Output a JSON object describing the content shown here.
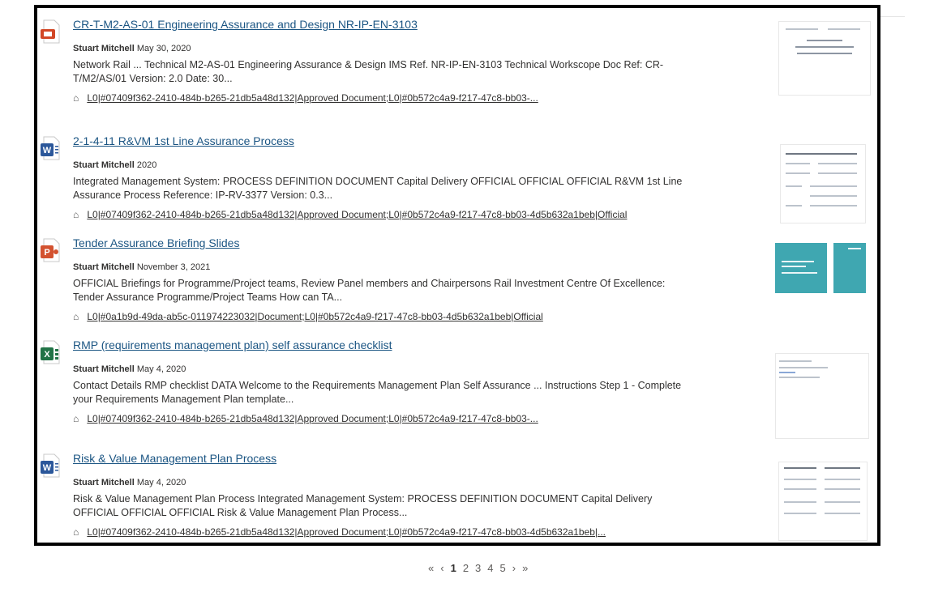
{
  "results": [
    {
      "type": "pdf",
      "title": "CR-T-M2-AS-01 Engineering Assurance and Design NR-IP-EN-3103",
      "author": "Stuart Mitchell",
      "date": "May 30, 2020",
      "snippet": "Network Rail ... Technical M2-AS-01 Engineering Assurance & Design IMS Ref. NR-IP-EN-3103 Technical Workscope Doc Ref: CR-T/M2/AS/01 Version: 2.0 Date: 30...",
      "tags": "L0|#07409f362-2410-484b-b265-21db5a48d132|Approved Document;L0|#0b572c4a9-f217-47c8-bb03-..."
    },
    {
      "type": "word",
      "title": "2-1-4-11 R&VM 1st Line Assurance Process",
      "author": "Stuart Mitchell",
      "date": "2020",
      "snippet": "Integrated Management System: PROCESS DEFINITION DOCUMENT Capital Delivery OFFICIAL OFFICIAL OFFICIAL R&VM 1st Line Assurance Process Reference: IP-RV-3377 Version: 0.3...",
      "tags": "L0|#07409f362-2410-484b-b265-21db5a48d132|Approved Document;L0|#0b572c4a9-f217-47c8-bb03-4d5b632a1beb|Official"
    },
    {
      "type": "powerpoint",
      "title": "Tender Assurance Briefing Slides",
      "author": "Stuart Mitchell",
      "date": "November 3, 2021",
      "snippet": "OFFICIAL Briefings for Programme/Project teams, Review Panel members and Chairpersons Rail Investment Centre Of Excellence: Tender Assurance Programme/Project Teams How can TA...",
      "tags": "L0|#0a1b9d-49da-ab5c-011974223032|Document;L0|#0b572c4a9-f217-47c8-bb03-4d5b632a1beb|Official"
    },
    {
      "type": "excel",
      "title": "RMP (requirements management plan) self assurance checklist",
      "author": "Stuart Mitchell",
      "date": "May 4, 2020",
      "snippet": "Contact Details RMP checklist DATA Welcome to the Requirements Management Plan Self Assurance ... Instructions Step 1 - Complete your Requirements Management Plan template...",
      "tags": "L0|#07409f362-2410-484b-b265-21db5a48d132|Approved Document;L0|#0b572c4a9-f217-47c8-bb03-..."
    },
    {
      "type": "word",
      "title": "Risk & Value Management Plan Process",
      "author": "Stuart Mitchell",
      "date": "May 4, 2020",
      "snippet": "Risk & Value Management Plan Process Integrated Management System: PROCESS DEFINITION DOCUMENT Capital Delivery OFFICIAL OFFICIAL OFFICIAL Risk & Value Management Plan Process...",
      "tags": "L0|#07409f362-2410-484b-b265-21db5a48d132|Approved Document;L0|#0b572c4a9-f217-47c8-bb03-4d5b632a1beb|..."
    }
  ],
  "pagination": {
    "first": "«",
    "prev": "‹",
    "pages": [
      "1",
      "2",
      "3",
      "4",
      "5"
    ],
    "current": "1",
    "next": "›",
    "last": "»"
  },
  "colors": {
    "link": "#1b5583",
    "pdf": "#d24726",
    "word": "#2b579a",
    "powerpoint": "#d35230",
    "excel": "#217346",
    "slide_teal": "#3fa7b1"
  }
}
